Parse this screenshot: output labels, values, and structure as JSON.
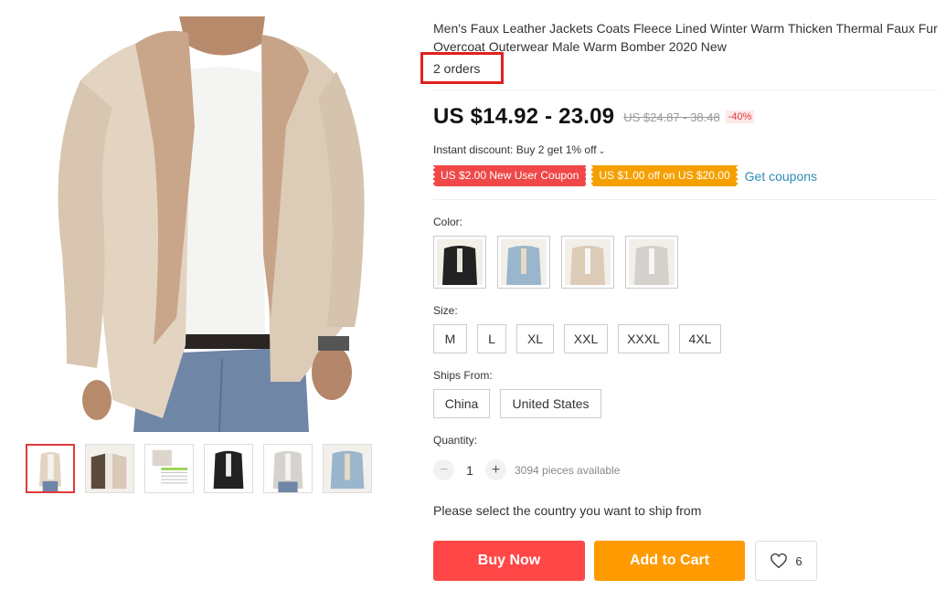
{
  "product": {
    "title": "Men's Faux Leather Jackets Coats Fleece Lined Winter Warm Thicken Thermal Faux Fur Overcoat Outerwear Male Warm Bomber 2020 New",
    "orders": "2 orders"
  },
  "pricing": {
    "price": "US $14.92 - 23.09",
    "original_price": "US $24.87 - 38.48",
    "discount": "-40%",
    "instant_discount": "Instant discount: Buy 2 get 1% off"
  },
  "coupons": {
    "new_user": "US $2.00 New User Coupon",
    "threshold": "US $1.00 off on US $20.00",
    "get_coupons": "Get coupons"
  },
  "color": {
    "label": "Color:",
    "swatches": [
      "black",
      "denim-blue",
      "beige",
      "light-grey"
    ]
  },
  "size": {
    "label": "Size:",
    "options": [
      "M",
      "L",
      "XL",
      "XXL",
      "XXXL",
      "4XL"
    ]
  },
  "ships_from": {
    "label": "Ships From:",
    "options": [
      "China",
      "United States"
    ]
  },
  "quantity": {
    "label": "Quantity:",
    "minus": "−",
    "plus": "+",
    "value": "1",
    "available": "3094 pieces available"
  },
  "ship_note": "Please select the country you want to ship from",
  "actions": {
    "buy_now": "Buy Now",
    "add_to_cart": "Add to Cart",
    "wishlist_count": "6"
  },
  "colors": {
    "buy": "#ff4747",
    "cart": "#ff9a00",
    "coupon_red": "#f04848",
    "coupon_orange": "#f5a000",
    "link": "#2f8db5",
    "highlight_box": "#e02020"
  }
}
